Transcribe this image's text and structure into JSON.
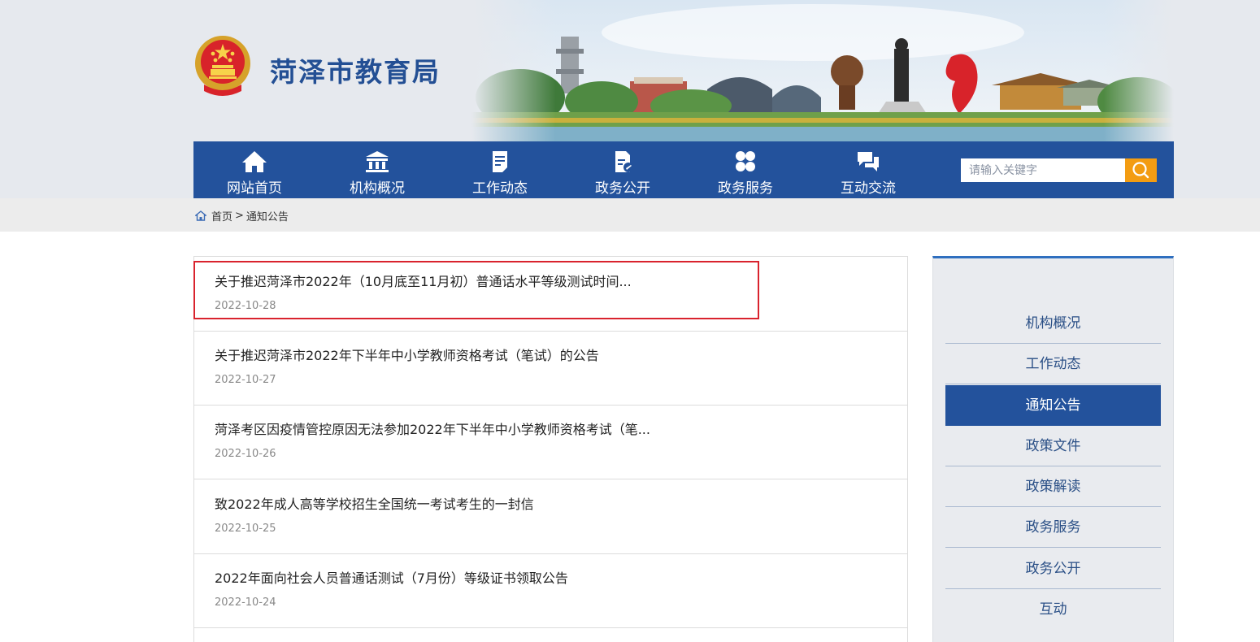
{
  "site": {
    "title": "菏泽市教育局"
  },
  "nav": {
    "items": [
      {
        "label": "网站首页",
        "icon": "home-icon"
      },
      {
        "label": "机构概况",
        "icon": "institution-icon"
      },
      {
        "label": "工作动态",
        "icon": "document-icon"
      },
      {
        "label": "政务公开",
        "icon": "file-edit-icon"
      },
      {
        "label": "政务服务",
        "icon": "grid-icon"
      },
      {
        "label": "互动交流",
        "icon": "chat-icon"
      }
    ],
    "search_placeholder": "请输入关键字"
  },
  "breadcrumb": {
    "home": "首页",
    "separator": ">",
    "current": "通知公告"
  },
  "articles": [
    {
      "title": "关于推迟菏泽市2022年（10月底至11月初）普通话水平等级测试时间...",
      "date": "2022-10-28"
    },
    {
      "title": "关于推迟菏泽市2022年下半年中小学教师资格考试（笔试）的公告",
      "date": "2022-10-27"
    },
    {
      "title": "菏泽考区因疫情管控原因无法参加2022年下半年中小学教师资格考试（笔...",
      "date": "2022-10-26"
    },
    {
      "title": "致2022年成人高等学校招生全国统一考试考生的一封信",
      "date": "2022-10-25"
    },
    {
      "title": "2022年面向社会人员普通话测试（7月份）等级证书领取公告",
      "date": "2022-10-24"
    }
  ],
  "sidebar": {
    "items": [
      {
        "label": "机构概况"
      },
      {
        "label": "工作动态"
      },
      {
        "label": "通知公告",
        "active": true
      },
      {
        "label": "政策文件"
      },
      {
        "label": "政策解读"
      },
      {
        "label": "政务服务"
      },
      {
        "label": "政务公开"
      },
      {
        "label": "互动"
      }
    ]
  },
  "colors": {
    "nav": "#23529c",
    "accent": "#f39c12",
    "highlight": "#d9232e",
    "title": "#234f94"
  }
}
